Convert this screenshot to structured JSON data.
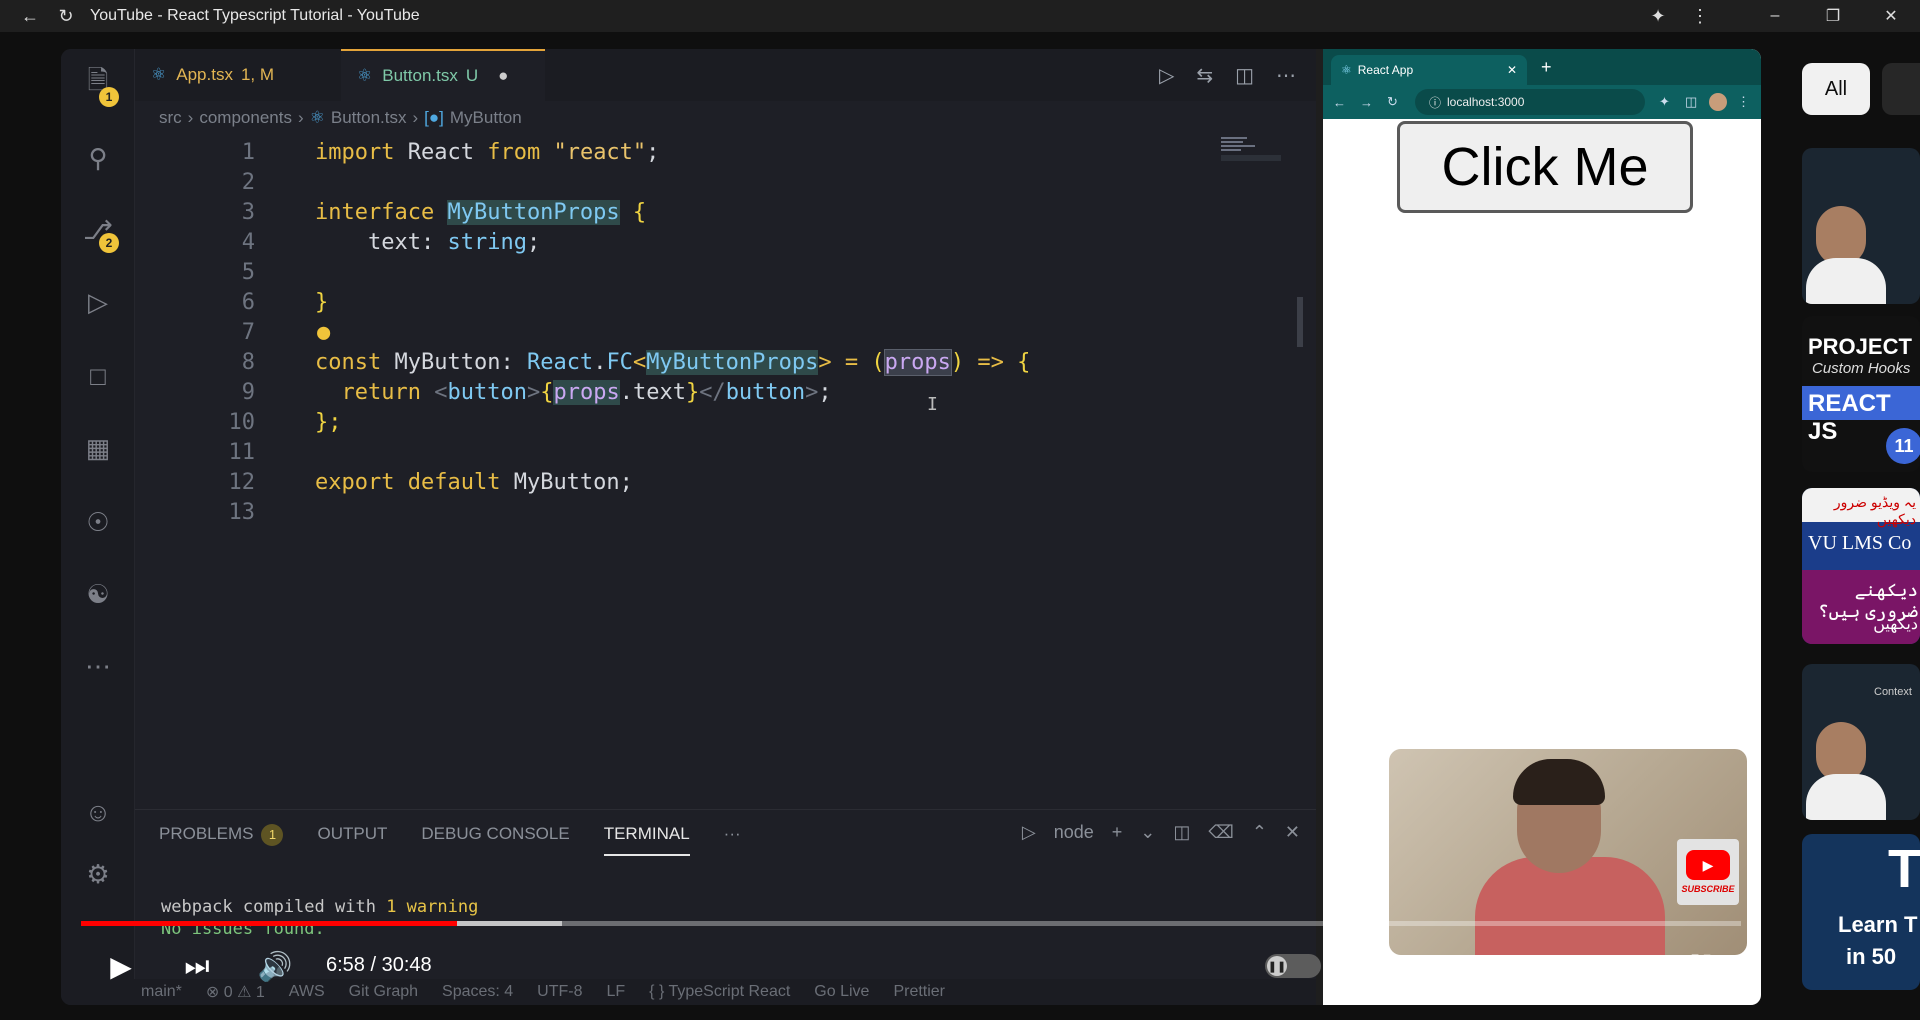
{
  "window": {
    "title": "YouTube - React Typescript Tutorial - YouTube"
  },
  "vscode": {
    "tabs": [
      {
        "name": "App.tsx",
        "status": "1, M"
      },
      {
        "name": "Button.tsx",
        "status": "U",
        "modified_dot": "●"
      }
    ],
    "breadcrumb": {
      "part1": "src",
      "part2": "components",
      "part3": "Button.tsx",
      "part4": "MyButton"
    },
    "activity_badges": {
      "explorer": "1",
      "source_control": "2"
    },
    "code_lines": [
      {
        "n": "1"
      },
      {
        "n": "2"
      },
      {
        "n": "3"
      },
      {
        "n": "4"
      },
      {
        "n": "5"
      },
      {
        "n": "6"
      },
      {
        "n": "7"
      },
      {
        "n": "8"
      },
      {
        "n": "9"
      },
      {
        "n": "10"
      },
      {
        "n": "11"
      },
      {
        "n": "12"
      },
      {
        "n": "13"
      }
    ],
    "code_tokens": {
      "import": "import",
      "react_id": "React",
      "from": "from",
      "react_str": "\"react\"",
      "semi": ";",
      "interface": "interface",
      "props_type": "MyButtonProps",
      "lbrace": "{",
      "rbrace": "}",
      "text_field": "text:",
      "string_type": "string",
      "const": "const",
      "mybutton": "MyButton",
      "colon": ":",
      "react_ns": "React",
      "dot": ".",
      "fc": "FC",
      "lt": "<",
      "gt": ">",
      "eq": "=",
      "lparen": "(",
      "props": "props",
      "rparen": ")",
      "arrow": "=>",
      "return": "return",
      "tag_open_lt": "<",
      "button": "button",
      "tag_open_gt": ">",
      "text": "text",
      "close_tag": "</",
      "end": "};",
      "export": "export",
      "default": "default"
    },
    "panel": {
      "tabs": [
        "PROBLEMS",
        "OUTPUT",
        "DEBUG CONSOLE",
        "TERMINAL"
      ],
      "problems_count": "1",
      "more": "···",
      "terminal_name": "node",
      "terminal_lines": {
        "line1_a": "webpack compiled with",
        "line1_b": "1 warning",
        "line2": "No issues found."
      }
    },
    "statusbar": [
      "main*",
      "⊗ 0 ⚠ 1",
      "AWS",
      "Git Graph",
      "Spaces: 4",
      "UTF-8",
      "LF",
      "{ } TypeScript React",
      "Go Live",
      "Prettier"
    ]
  },
  "browser": {
    "tab_title": "React App",
    "url": "localhost:3000",
    "button_label": "Click Me"
  },
  "player": {
    "current_time": "6:58",
    "duration": "30:48",
    "time_display": "6:58 / 30:48",
    "progress_fraction": 0.2266,
    "buffered_fraction": 0.29,
    "subscribe_label": "SUBSCRIBE"
  },
  "sidebar": {
    "chips": [
      "All"
    ],
    "thumbs": [
      {
        "text_a": "",
        "text_b": ""
      },
      {
        "text_a": "PROJECT",
        "text_b": "Custom Hooks",
        "text_c": "REACT JS",
        "badge": "11"
      },
      {
        "text_a": "یہ ویڈیو ضرور دیکھیں",
        "text_b": "VU LMS Co",
        "text_c": "دیکھنے ضروری ہیں؟",
        "text_d": "دیکھیں"
      },
      {
        "text_a": "Context",
        "text_b": ""
      },
      {
        "text_a": "T",
        "text_b": "Learn T",
        "text_c": "in 50"
      }
    ]
  }
}
